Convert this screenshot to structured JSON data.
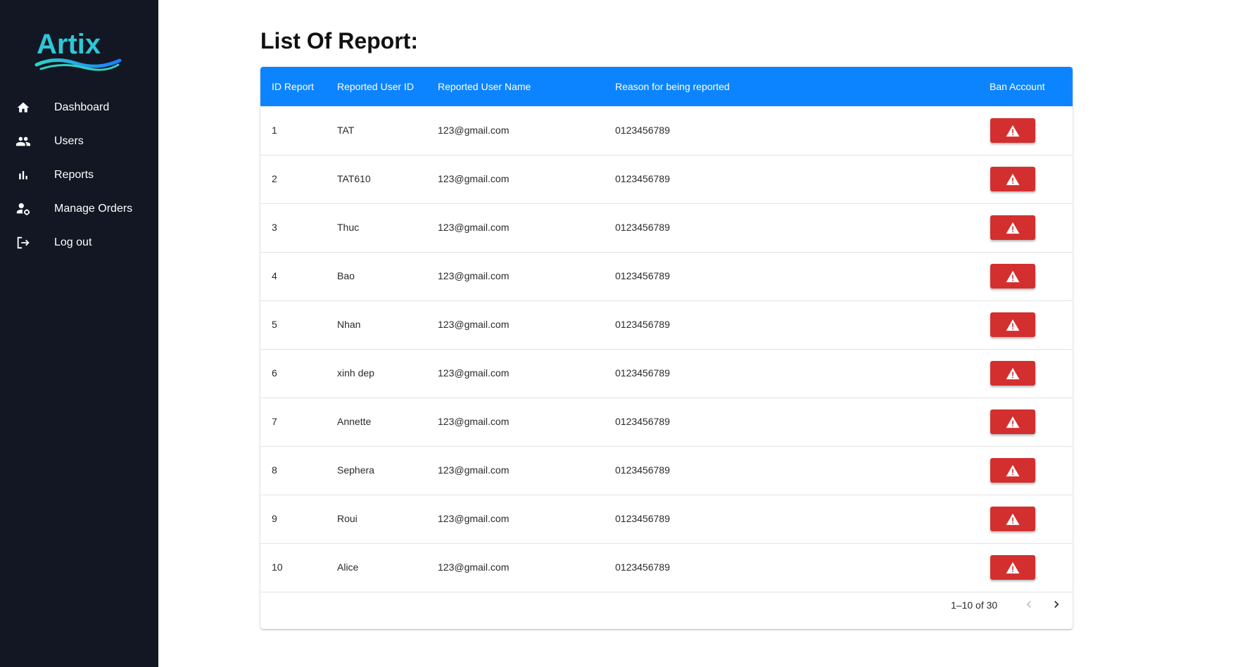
{
  "app": {
    "logo_text": "Artix",
    "accent_color": "#0d84ff",
    "danger_color": "#d32f2f",
    "sidebar_color": "#121723"
  },
  "sidebar": {
    "items": [
      {
        "label": "Dashboard",
        "icon": "home-icon"
      },
      {
        "label": "Users",
        "icon": "users-icon"
      },
      {
        "label": "Reports",
        "icon": "bar-chart-icon"
      },
      {
        "label": "Manage Orders",
        "icon": "user-gear-icon"
      },
      {
        "label": "Log out",
        "icon": "logout-icon"
      }
    ]
  },
  "main": {
    "title": "List Of Report:",
    "table": {
      "columns": [
        "ID Report",
        "Reported User ID",
        "Reported User Name",
        "Reason for being reported",
        "Ban Account"
      ],
      "ban_icon": "warning-icon",
      "rows": [
        {
          "id": "1",
          "user_id": "TAT",
          "user_name": "123@gmail.com",
          "reason": "0123456789"
        },
        {
          "id": "2",
          "user_id": "TAT610",
          "user_name": "123@gmail.com",
          "reason": "0123456789"
        },
        {
          "id": "3",
          "user_id": "Thuc",
          "user_name": "123@gmail.com",
          "reason": "0123456789"
        },
        {
          "id": "4",
          "user_id": "Bao",
          "user_name": "123@gmail.com",
          "reason": "0123456789"
        },
        {
          "id": "5",
          "user_id": "Nhan",
          "user_name": "123@gmail.com",
          "reason": "0123456789"
        },
        {
          "id": "6",
          "user_id": "xinh dep",
          "user_name": "123@gmail.com",
          "reason": "0123456789"
        },
        {
          "id": "7",
          "user_id": "Annette",
          "user_name": "123@gmail.com",
          "reason": "0123456789"
        },
        {
          "id": "8",
          "user_id": "Sephera",
          "user_name": "123@gmail.com",
          "reason": "0123456789"
        },
        {
          "id": "9",
          "user_id": "Roui",
          "user_name": "123@gmail.com",
          "reason": "0123456789"
        },
        {
          "id": "10",
          "user_id": "Alice",
          "user_name": "123@gmail.com",
          "reason": "0123456789"
        }
      ]
    },
    "pagination": {
      "range_text": "1–10 of 30",
      "prev_icon": "chevron-left-icon",
      "next_icon": "chevron-right-icon",
      "prev_disabled": true
    }
  }
}
